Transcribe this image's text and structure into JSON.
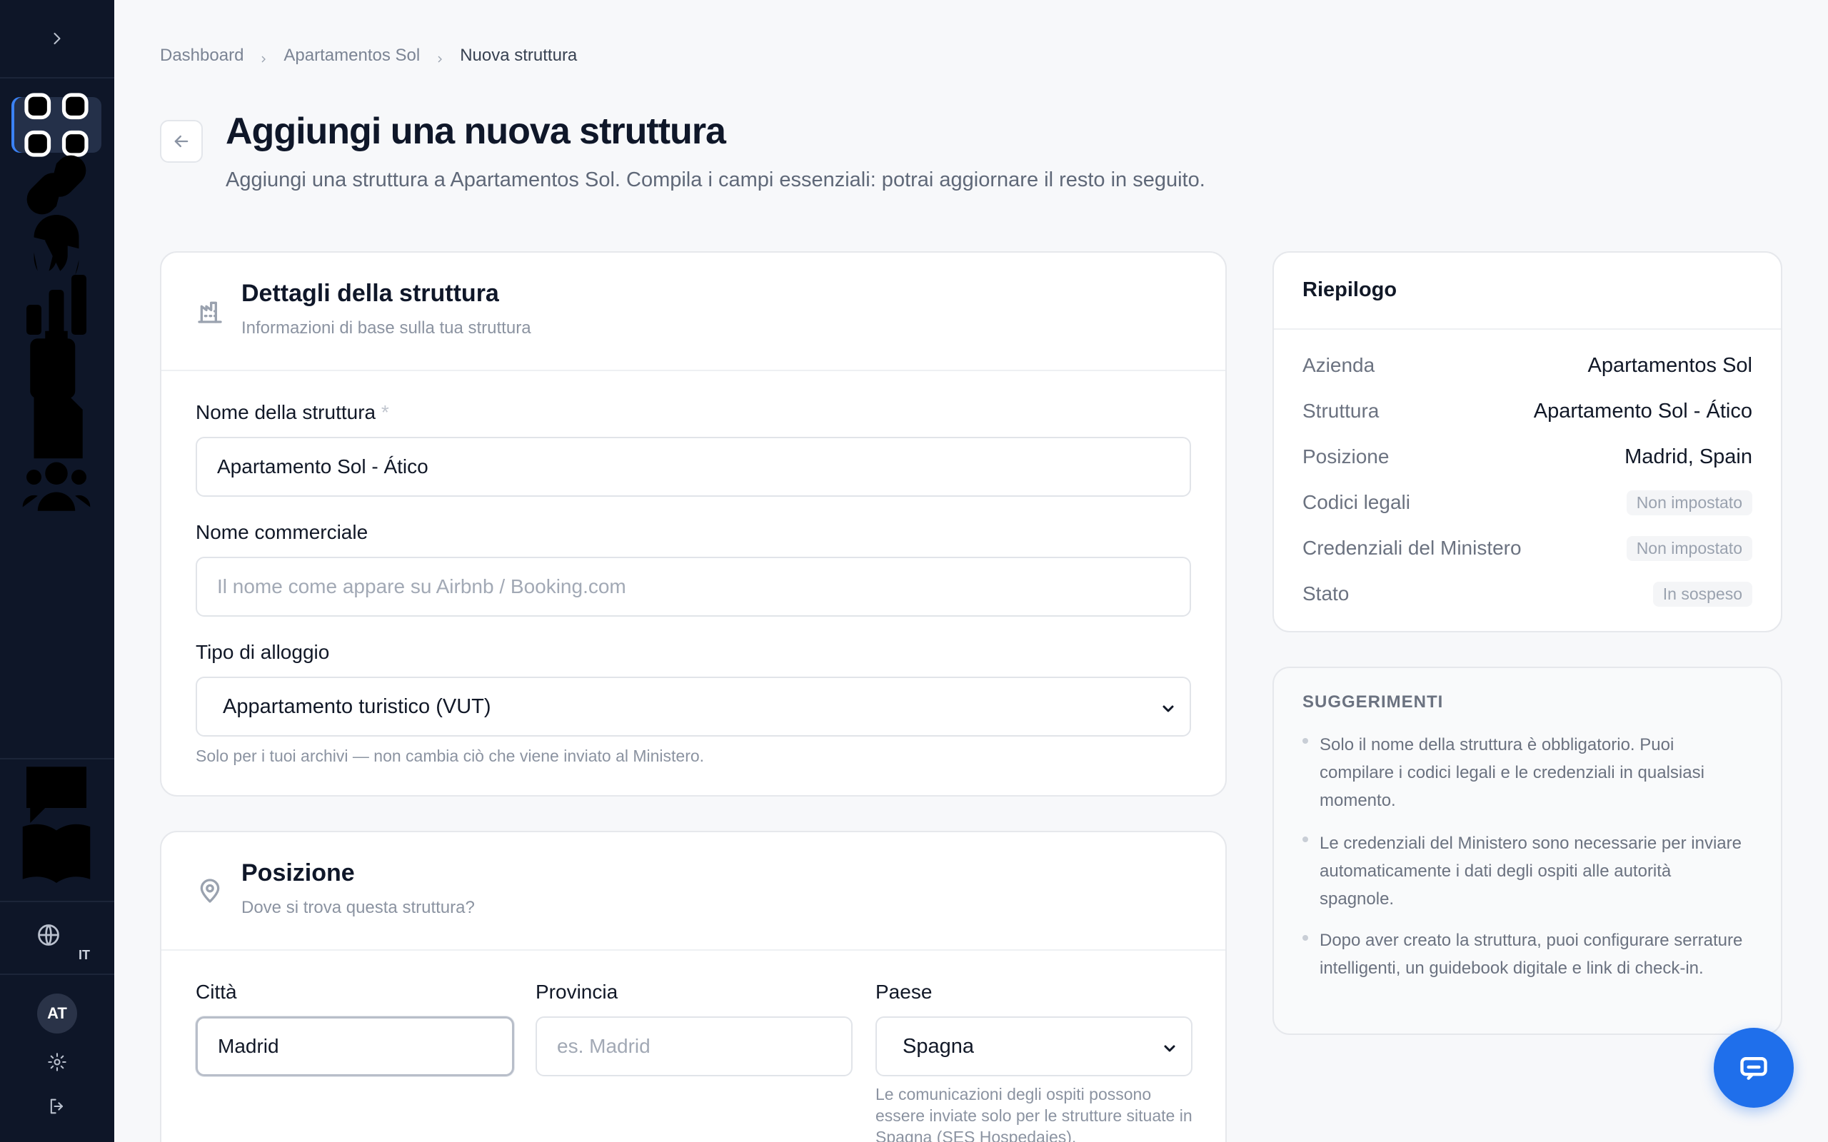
{
  "sidebar": {
    "nav_icons": [
      "dashboard-icon",
      "link-icon",
      "fingerprint-icon",
      "bar-chart-icon",
      "clipboard-check-icon",
      "document-icon",
      "users-icon"
    ],
    "bottom_icons": [
      "chat-icon",
      "book-icon"
    ],
    "language": "IT",
    "avatar_initials": "AT"
  },
  "breadcrumb": {
    "items": [
      "Dashboard",
      "Apartamentos Sol",
      "Nuova struttura"
    ]
  },
  "header": {
    "title": "Aggiungi una nuova struttura",
    "subtitle": "Aggiungi una struttura a Apartamentos Sol. Compila i campi essenziali: potrai aggiornare il resto in seguito."
  },
  "details_card": {
    "title": "Dettagli della struttura",
    "subtitle": "Informazioni di base sulla tua struttura",
    "name_label": "Nome della struttura",
    "name_required": "*",
    "name_value": "Apartamento Sol - Ático",
    "commercial_label": "Nome commerciale",
    "commercial_placeholder": "Il nome come appare su Airbnb / Booking.com",
    "type_label": "Tipo di alloggio",
    "type_value": "Appartamento turistico (VUT)",
    "type_hint": "Solo per i tuoi archivi — non cambia ciò che viene inviato al Ministero."
  },
  "location_card": {
    "title": "Posizione",
    "subtitle": "Dove si trova questa struttura?",
    "city_label": "Città",
    "city_value": "Madrid",
    "province_label": "Provincia",
    "province_placeholder": "es. Madrid",
    "country_label": "Paese",
    "country_value": "Spagna",
    "country_hint": "Le comunicazioni degli ospiti possono essere inviate solo per le strutture situate in Spagna (SES Hospedajes)."
  },
  "summary": {
    "title": "Riepilogo",
    "rows": [
      {
        "key": "Azienda",
        "value": "Apartamentos Sol"
      },
      {
        "key": "Struttura",
        "value": "Apartamento Sol - Ático"
      },
      {
        "key": "Posizione",
        "value": "Madrid, Spain"
      },
      {
        "key": "Codici legali",
        "value": "Non impostato"
      },
      {
        "key": "Credenziali del Ministero",
        "value": "Non impostato"
      },
      {
        "key": "Stato",
        "value": "In sospeso"
      }
    ]
  },
  "tips": {
    "title": "SUGGERIMENTI",
    "items": [
      "Solo il nome della struttura è obbligatorio. Puoi compilare i codici legali e le credenziali in qualsiasi momento.",
      "Le credenziali del Ministero sono necessarie per inviare automaticamente i dati degli ospiti alle autorità spagnole.",
      "Dopo aver creato la struttura, puoi configurare serrature intelligenti, un guidebook digitale e link di check-in."
    ]
  },
  "colors": {
    "sidebar_bg": "#0e1628",
    "accent": "#1f6feb"
  }
}
